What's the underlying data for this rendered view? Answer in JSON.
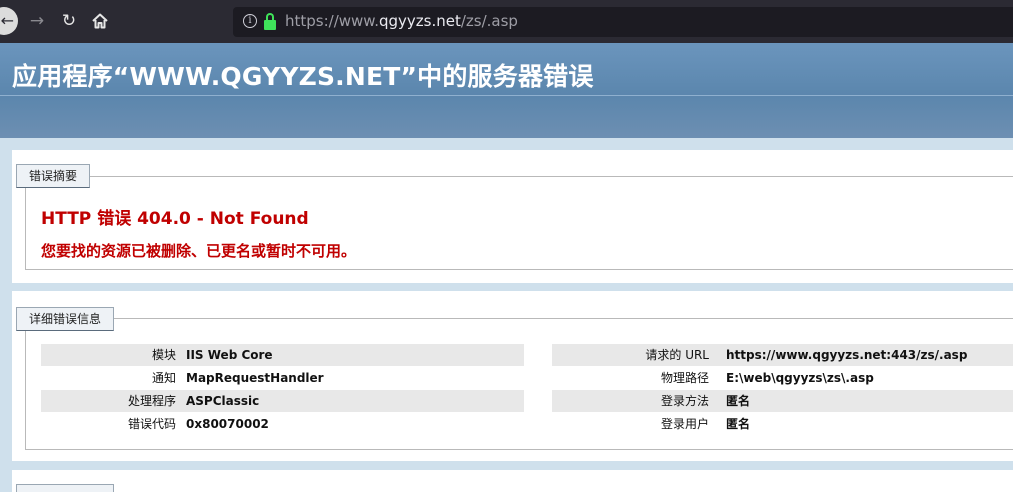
{
  "browser": {
    "back_icon": "back-arrow-icon",
    "forward_icon": "forward-arrow-icon",
    "reload_icon": "reload-icon",
    "home_icon": "home-icon",
    "url_prefix": "https://www.",
    "url_host": "qgyyzs.net",
    "url_path": "/zs/.asp",
    "lock_color": "#3fe35a"
  },
  "header": {
    "title": "应用程序“WWW.QGYYZS.NET”中的服务器错误"
  },
  "summary": {
    "legend": "错误摘要",
    "error_title": "HTTP 错误 404.0 - Not Found",
    "error_message": "您要找的资源已被删除、已更名或暂时不可用。",
    "error_color": "#c00000"
  },
  "details": {
    "legend": "详细错误信息",
    "left_rows": [
      {
        "label": "模块",
        "value": "IIS Web Core"
      },
      {
        "label": "通知",
        "value": "MapRequestHandler"
      },
      {
        "label": "处理程序",
        "value": "ASPClassic"
      },
      {
        "label": "错误代码",
        "value": "0x80070002"
      }
    ],
    "right_rows": [
      {
        "label": "请求的 URL",
        "value": "https://www.qgyyzs.net:443/zs/.asp"
      },
      {
        "label": "物理路径",
        "value": "E:\\web\\qgyyzs\\zs\\.asp"
      },
      {
        "label": "登录方法",
        "value": "匿名"
      },
      {
        "label": "登录用户",
        "value": "匿名"
      }
    ]
  }
}
